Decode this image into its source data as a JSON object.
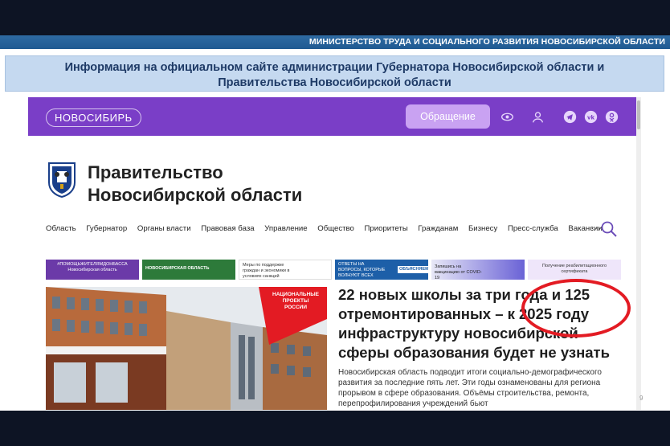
{
  "header": {
    "ministry": "МИНИСТЕРСТВО ТРУДА И СОЦИАЛЬНОГО РАЗВИТИЯ НОВОСИБИРСКОЙ ОБЛАСТИ"
  },
  "info_box": {
    "line1": "Информация на официальном сайте администрации Губернатора Новосибирской области и",
    "line2": "Правительства Новосибирской области"
  },
  "site": {
    "logo": "НОВОСИБИРЬ",
    "appeal_button": "Обращение",
    "icons": [
      "eye-icon",
      "user-icon",
      "telegram-icon",
      "vk-icon",
      "odnoklassniki-icon"
    ],
    "brand_line1": "Правительство",
    "brand_line2": "Новосибирской области",
    "nav": [
      "Область",
      "Губернатор",
      "Органы власти",
      "Правовая база",
      "Управление",
      "Общество",
      "Приоритеты",
      "Гражданам",
      "Бизнесу",
      "Пресс-служба",
      "Вакансии"
    ],
    "nav_more": "···",
    "banners": [
      {
        "line1": "#ПОМОЩЬЖИТЕЛЯМДОНБАССА",
        "line2": "Новосибирская область"
      },
      {
        "line1": "НОВОСИБИРСКАЯ ОБЛАСТЬ",
        "line2": ""
      },
      {
        "line1": "Меры по поддержке граждан и экономики в условиях санкций",
        "line2": ""
      },
      {
        "line1": "ОТВЕТЫ НА ВОПРОСЫ, КОТОРЫЕ ВОЛНУЮТ ВСЕХ",
        "line2": "ОБЪЯСНЯЕМ.РФ"
      },
      {
        "line1": "Запишись на вакцинацию от COVID-19",
        "line2": ""
      },
      {
        "line1": "Получение реабилитационного",
        "line2": "сертификата"
      }
    ],
    "hero": {
      "badge": "НАЦИОНАЛЬНЫЕ ПРОЕКТЫ РОССИИ",
      "title": "22 новых школы за три года и 125 отремонтированных – к 2025 году инфраструктуру новосибирской сферы образования будет не узнать",
      "text": "Новосибирская область подводит итоги социально-демографического развития за последние пять лет. Эти годы ознаменованы для региона прорывом в сфере образования. Объёмы строительства, ремонта, перепрофилирования учреждений бьют"
    }
  },
  "colors": {
    "purple": "#7a3ec7",
    "highlight": "#e31b23",
    "banner_bar": "#1f5a92"
  },
  "page_number": "9"
}
